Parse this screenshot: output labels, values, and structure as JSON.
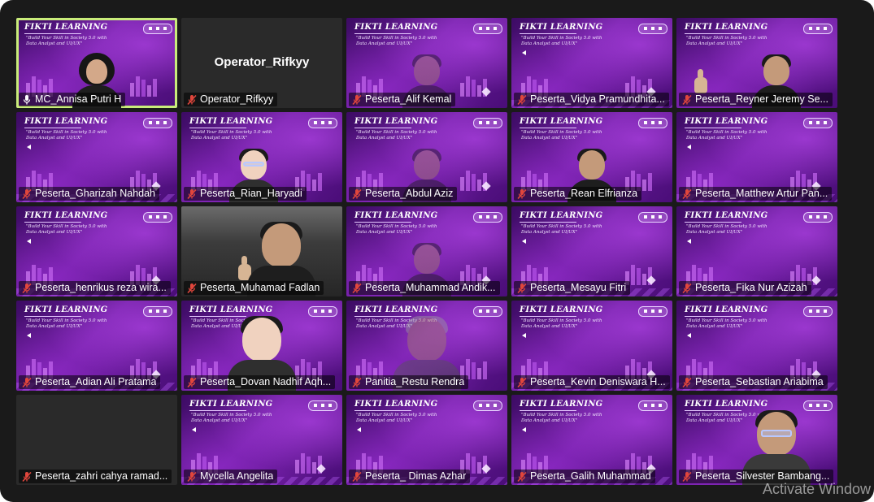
{
  "participants": [
    {
      "name": "MC_Annisa Putri H",
      "mic": "unmuted",
      "video": "camera"
    },
    {
      "name": "Operator_Rifkyy",
      "display_name": "Operator_Rifkyy",
      "mic": "muted",
      "video": "off"
    },
    {
      "name": "Peserta_Alif Kemal",
      "mic": "muted",
      "video": "camera"
    },
    {
      "name": "Peserta_Vidya Pramundhita...",
      "mic": "muted",
      "video": "background"
    },
    {
      "name": "Peserta_Reyner Jeremy Se...",
      "mic": "muted",
      "video": "camera"
    },
    {
      "name": "Peserta_Gharizah Nahdah",
      "mic": "muted",
      "video": "background"
    },
    {
      "name": "Peserta_Rian_Haryadi",
      "mic": "muted",
      "video": "camera"
    },
    {
      "name": "Peserta_Abdul Aziz",
      "mic": "muted",
      "video": "camera"
    },
    {
      "name": "Peserta_Rean Elfrianza",
      "mic": "muted",
      "video": "camera"
    },
    {
      "name": "Peserta_Matthew Artur Pan...",
      "mic": "muted",
      "video": "background"
    },
    {
      "name": "Peserta_henrikus reza wira...",
      "mic": "muted",
      "video": "background"
    },
    {
      "name": "Peserta_Muhamad Fadlan",
      "mic": "muted",
      "video": "camera"
    },
    {
      "name": "Peserta_Muhammad Andik...",
      "mic": "muted",
      "video": "camera"
    },
    {
      "name": "Peserta_Mesayu Fitri",
      "mic": "muted",
      "video": "background"
    },
    {
      "name": "Peserta_Fika Nur Azizah",
      "mic": "muted",
      "video": "background"
    },
    {
      "name": "Peserta_Adian Ali Pratama",
      "mic": "muted",
      "video": "background"
    },
    {
      "name": "Peserta_Dovan Nadhif Aqh...",
      "mic": "muted",
      "video": "camera"
    },
    {
      "name": "Panitia_Restu Rendra",
      "mic": "muted",
      "video": "camera"
    },
    {
      "name": "Peserta_Kevin Deniswara H...",
      "mic": "muted",
      "video": "background"
    },
    {
      "name": "Peserta_Sebastian Ariabima",
      "mic": "muted",
      "video": "background"
    },
    {
      "name": "Peserta_zahri cahya ramad...",
      "mic": "muted",
      "video": "off"
    },
    {
      "name": "Mycella Angelita",
      "mic": "muted",
      "video": "background"
    },
    {
      "name": "Peserta_ Dimas Azhar",
      "mic": "muted",
      "video": "background"
    },
    {
      "name": "Peserta_Galih Muhammad",
      "mic": "muted",
      "video": "background"
    },
    {
      "name": "Peserta_Silvester Bambang...",
      "mic": "muted",
      "video": "camera"
    }
  ],
  "background": {
    "brand": "FIKTI LEARNING",
    "tagline": "\"Build Your Skill in Society 5.0 with Data Analyst and UI/UX\""
  },
  "active_speaker": "MC_Annisa Putri H",
  "colors": {
    "active_border": "#c9ec7a",
    "muted_icon": "#e0463c",
    "purple_bg": "#6d1fa0"
  },
  "watermark": "Activate Window"
}
